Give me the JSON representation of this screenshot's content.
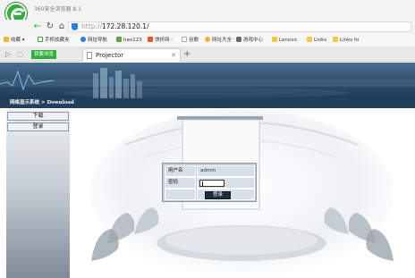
{
  "browser": {
    "title": "360安全浏览器 8.1",
    "url_protocol": "http://",
    "url_host": "172.28.120.1/",
    "bookmarks": [
      {
        "label": "收藏",
        "icon": "star-icon"
      },
      {
        "label": "手机收藏夹",
        "icon": "phone-icon"
      },
      {
        "label": "网址导航",
        "icon": "globe-icon"
      },
      {
        "label": "hao123",
        "icon": "hao123-icon"
      },
      {
        "label": "快折网 -",
        "icon": "kuaizhe-icon"
      },
      {
        "label": "谷歌",
        "icon": "page-icon"
      },
      {
        "label": "网址大全",
        "icon": "smile-icon"
      },
      {
        "label": "游戏中心",
        "icon": "gamepad-icon"
      },
      {
        "label": "Lenovo",
        "icon": "folder-icon"
      },
      {
        "label": "Links",
        "icon": "folder-icon"
      },
      {
        "label": "Links fo",
        "icon": "folder-icon"
      }
    ],
    "tabs": {
      "safe_label": "我要浏览",
      "active_label": "Projector"
    }
  },
  "page": {
    "breadcrumb": "网络显示系统 > Download",
    "menu": {
      "download": "下载",
      "login": "登录"
    },
    "login": {
      "username_label": "用户名",
      "username_value": "admin",
      "password_label": "密码",
      "submit_label": "登录"
    }
  },
  "colors": {
    "brand_green": "#2fae3a",
    "header_blue": "#2d4f6e",
    "path_bar": "#223f5c",
    "form_bg": "#d7e0e8",
    "button_dark": "#1e2e3c"
  }
}
